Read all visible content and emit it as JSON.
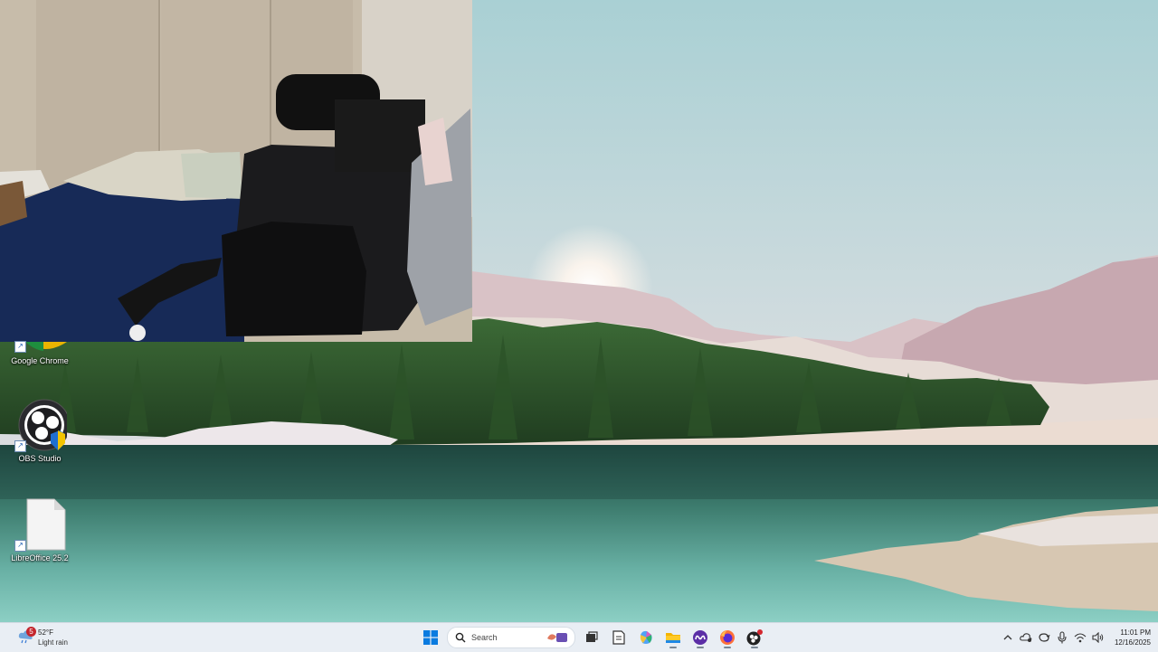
{
  "desktop": {
    "icons": [
      {
        "label": "Google Chrome",
        "icon": "google-chrome-icon"
      },
      {
        "label": "OBS Studio",
        "icon": "obs-studio-icon"
      },
      {
        "label": "LibreOffice 25.2",
        "icon": "libreoffice-icon"
      }
    ]
  },
  "taskbar": {
    "weather": {
      "badge": "5",
      "temperature": "52°F",
      "condition": "Light rain"
    },
    "search": {
      "placeholder": "Search"
    },
    "apps": [
      {
        "icon": "start-windows-icon"
      },
      {
        "icon": "task-view-icon"
      },
      {
        "icon": "notepad-icon"
      },
      {
        "icon": "copilot-icon"
      },
      {
        "icon": "file-explorer-icon"
      },
      {
        "icon": "meta-app-icon"
      },
      {
        "icon": "firefox-icon"
      },
      {
        "icon": "obs-taskbar-icon"
      }
    ],
    "tray": {
      "icons": [
        "chevron-up-icon",
        "onedrive-icon",
        "sync-icon",
        "microphone-icon",
        "wifi-icon",
        "volume-icon"
      ],
      "time": "11:01 PM",
      "date": "12/16/2025"
    }
  },
  "colors": {
    "taskbar_bg": "#e9eef4",
    "accent": "#0067c0",
    "badge": "#c4262e"
  }
}
